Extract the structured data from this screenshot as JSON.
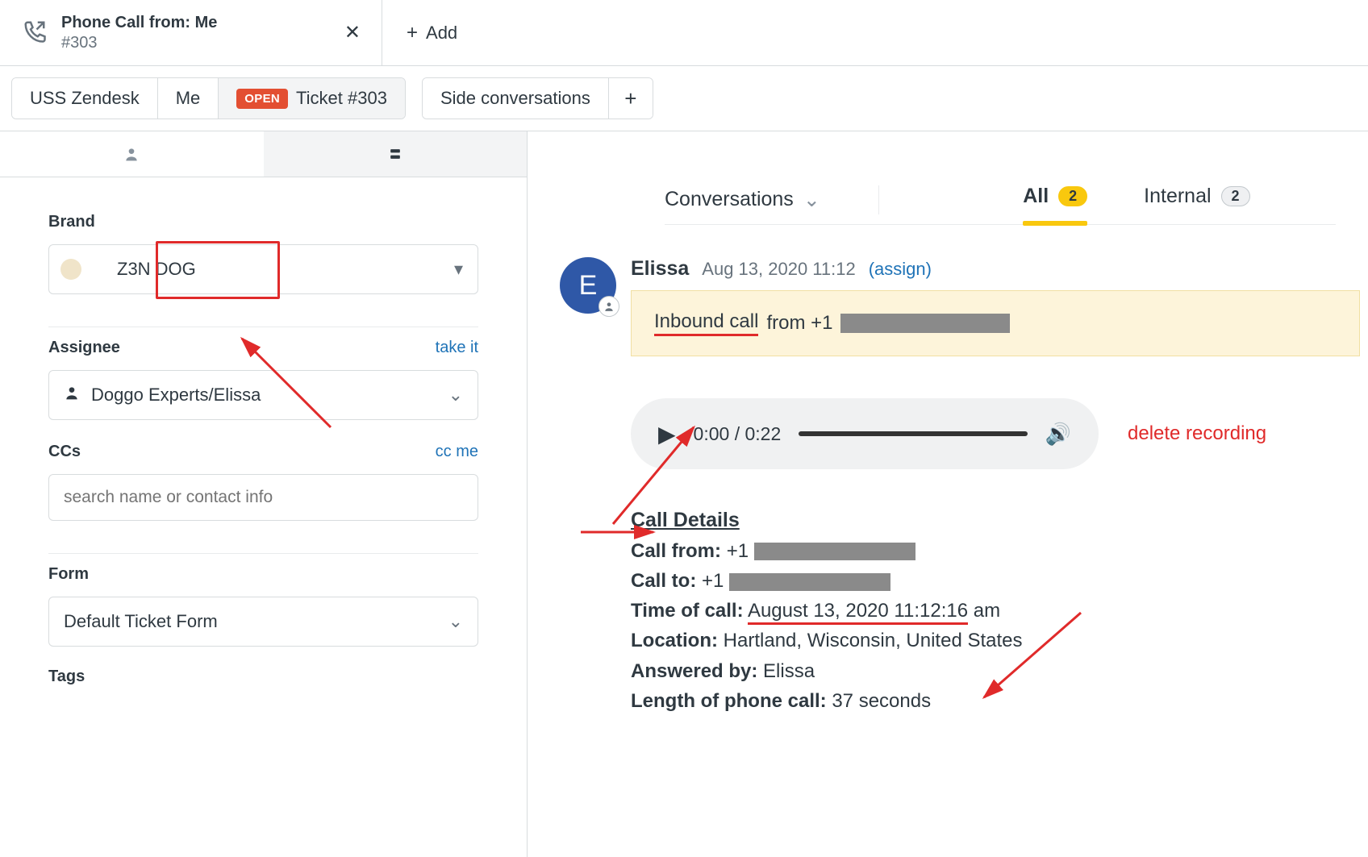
{
  "topbar": {
    "tab_title": "Phone Call from: Me",
    "tab_sub": "#303",
    "add_label": "Add"
  },
  "breadcrumb": {
    "org": "USS Zendesk",
    "user": "Me",
    "status": "OPEN",
    "ticket": "Ticket #303",
    "side_conv": "Side conversations"
  },
  "sidebar": {
    "brand_label": "Brand",
    "brand_value": "Z3N DOG",
    "assignee_label": "Assignee",
    "assignee_takeit": "take it",
    "assignee_value": "Doggo Experts/Elissa",
    "ccs_label": "CCs",
    "ccs_ccme": "cc me",
    "ccs_placeholder": "search name or contact info",
    "form_label": "Form",
    "form_value": "Default Ticket Form",
    "tags_label": "Tags"
  },
  "conv": {
    "conversations": "Conversations",
    "tab_all": "All",
    "tab_all_count": "2",
    "tab_internal": "Internal",
    "tab_internal_count": "2"
  },
  "message": {
    "avatar_initial": "E",
    "name": "Elissa",
    "date": "Aug 13, 2020 11:12",
    "assign": "(assign)",
    "note_prefix": "Inbound call ",
    "note_from": "from +1",
    "audio_time": "0:00 / 0:22",
    "delete_recording": "delete recording"
  },
  "call_details": {
    "header": "Call Details",
    "call_from_label": "Call from:",
    "call_from_value": "+1",
    "call_to_label": "Call to:",
    "call_to_value": "+1",
    "time_label": "Time of call:",
    "time_value_a": "August 13, 2020 11:12:16",
    "time_value_b": " am",
    "location_label": "Location:",
    "location_value": "Hartland, Wisconsin, United States",
    "answered_label": "Answered by:",
    "answered_value": "Elissa",
    "length_label": "Length of phone call:",
    "length_value": "37 seconds"
  }
}
